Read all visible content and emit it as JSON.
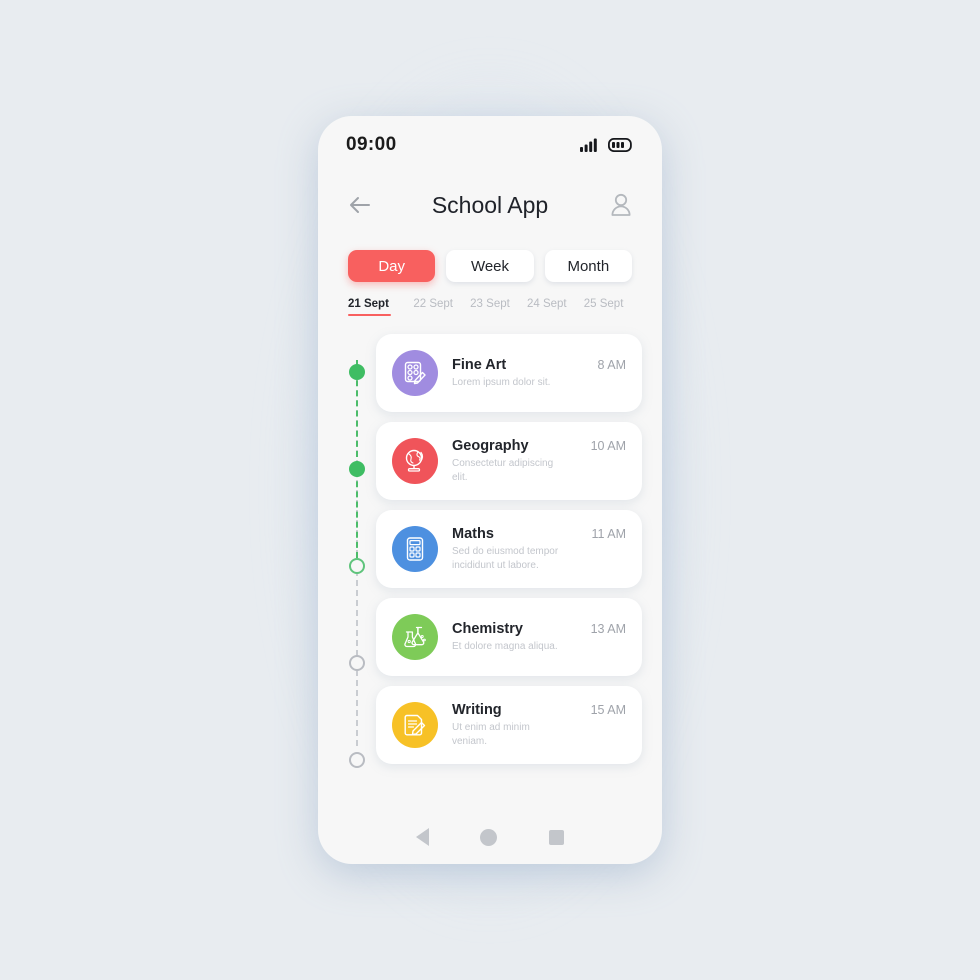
{
  "status_bar": {
    "time": "09:00",
    "signal_icon": "signal-bars-icon",
    "battery_icon": "battery-icon"
  },
  "app_bar": {
    "title": "School App",
    "back_icon": "arrow-left-icon",
    "avatar_icon": "user-avatar-icon"
  },
  "segmented": {
    "options": [
      {
        "label": "Day",
        "active": true
      },
      {
        "label": "Week",
        "active": false
      },
      {
        "label": "Month",
        "active": false
      }
    ],
    "active_color": "#f8605f"
  },
  "dates": [
    {
      "label": "21 Sept",
      "active": true
    },
    {
      "label": "22 Sept",
      "active": false
    },
    {
      "label": "23 Sept",
      "active": false
    },
    {
      "label": "24 Sept",
      "active": false
    },
    {
      "label": "25 Sept",
      "active": false
    }
  ],
  "timeline": {
    "markers": [
      {
        "state": "filled",
        "color": "#3fbd63"
      },
      {
        "state": "filled",
        "color": "#3fbd63"
      },
      {
        "state": "ring-green",
        "color": "#5fc47c"
      },
      {
        "state": "ring-grey",
        "color": "#b9bcc2"
      },
      {
        "state": "ring-grey",
        "color": "#b9bcc2"
      }
    ],
    "line_done_color": "#4cbd6a",
    "line_todo_color": "#c9ccd1"
  },
  "lessons": [
    {
      "title": "Fine Art",
      "time": "8 AM",
      "subtitle": "Lorem ipsum dolor sit.",
      "icon": "palette-icon",
      "color": "#a08ce0"
    },
    {
      "title": "Geography",
      "time": "10 AM",
      "subtitle": "Consectetur adipiscing elit.",
      "icon": "globe-icon",
      "color": "#f0545a"
    },
    {
      "title": "Maths",
      "time": "11 AM",
      "subtitle": "Sed do eiusmod tempor incididunt ut labore.",
      "icon": "calculator-icon",
      "color": "#4d90e0"
    },
    {
      "title": "Chemistry",
      "time": "13 AM",
      "subtitle": "Et dolore magna aliqua.",
      "icon": "flask-icon",
      "color": "#7ecb58"
    },
    {
      "title": "Writing",
      "time": "15 AM",
      "subtitle": "Ut enim ad minim veniam.",
      "icon": "document-pencil-icon",
      "color": "#f7c126"
    }
  ],
  "bottom_nav": [
    {
      "icon": "nav-back-icon"
    },
    {
      "icon": "nav-home-icon"
    },
    {
      "icon": "nav-recents-icon"
    }
  ]
}
